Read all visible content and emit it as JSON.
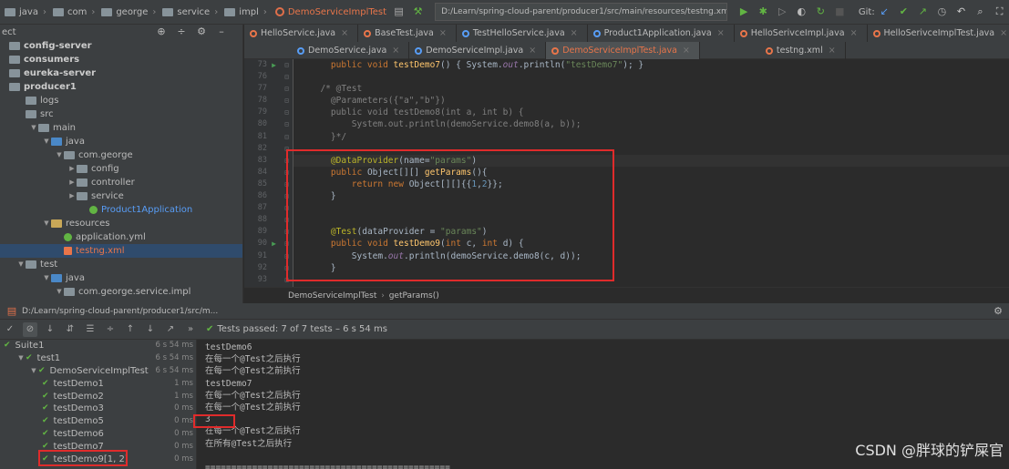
{
  "nav": {
    "crumbs": [
      "java",
      "com",
      "george",
      "service",
      "impl"
    ],
    "file": "DemoServiceImplTest",
    "path": "D:/Learn/spring-cloud-parent/producer1/src/main/resources/testng.xml",
    "git_label": "Git:"
  },
  "tree": {
    "header": "ect",
    "rows": [
      {
        "label": "config-server",
        "type": "f",
        "bold": true,
        "indent": 0
      },
      {
        "label": "consumers",
        "type": "f",
        "bold": true,
        "indent": 0
      },
      {
        "label": "eureka-server",
        "type": "f",
        "bold": true,
        "indent": 0
      },
      {
        "label": "producer1",
        "type": "f",
        "bold": true,
        "indent": 0
      },
      {
        "label": "logs",
        "type": "f",
        "indent": 1
      },
      {
        "label": "src",
        "type": "f",
        "indent": 1
      },
      {
        "label": "main",
        "type": "f",
        "indent": 2,
        "arrow": "down"
      },
      {
        "label": "java",
        "type": "b",
        "indent": 3,
        "arrow": "down"
      },
      {
        "label": "com.george",
        "type": "f",
        "indent": 4,
        "arrow": "down"
      },
      {
        "label": "config",
        "type": "f",
        "indent": 5,
        "arrow": "right"
      },
      {
        "label": "controller",
        "type": "f",
        "indent": 5,
        "arrow": "right"
      },
      {
        "label": "service",
        "type": "f",
        "indent": 5,
        "arrow": "right"
      },
      {
        "label": "Product1Application",
        "type": "g",
        "indent": 6,
        "cls": "link"
      },
      {
        "label": "resources",
        "type": "y",
        "indent": 3,
        "arrow": "down"
      },
      {
        "label": "application.yml",
        "type": "g",
        "indent": 4
      },
      {
        "label": "testng.xml",
        "type": "x",
        "indent": 4,
        "cls": "orange",
        "selected": true
      },
      {
        "label": "test",
        "type": "f",
        "indent": 1,
        "arrow": "down"
      },
      {
        "label": "java",
        "type": "b",
        "indent": 3,
        "arrow": "down"
      },
      {
        "label": "com.george.service.impl",
        "type": "f",
        "indent": 4,
        "arrow": "down"
      }
    ]
  },
  "tabs": {
    "row1": [
      {
        "label": "HelloService.java",
        "k": "j"
      },
      {
        "label": "BaseTest.java",
        "k": "j"
      },
      {
        "label": "TestHelloService.java",
        "k": "t"
      },
      {
        "label": "Product1Application.java",
        "k": "t"
      },
      {
        "label": "HelloSerivceImpl.java",
        "k": "j"
      },
      {
        "label": "HelloSerivceImplTest.java",
        "k": "j"
      }
    ],
    "row2": [
      {
        "label": "DemoService.java",
        "k": "t"
      },
      {
        "label": "DemoServiceImpl.java",
        "k": "t"
      },
      {
        "label": "DemoServiceImplTest.java",
        "k": "j",
        "active": true
      },
      {
        "label": "testng.xml",
        "k": "x"
      }
    ]
  },
  "code": {
    "lines": [
      {
        "n": "73",
        "run": true,
        "html": "    <span class='kw'>public void </span><span class='fn'>testDemo7</span>() { System.<span class='fi'>out</span>.println(<span class='st'>\"testDemo7\"</span>); }"
      },
      {
        "n": "76",
        "html": ""
      },
      {
        "n": "77",
        "html": "  <span class='cm'>/* @Test</span>"
      },
      {
        "n": "78",
        "html": "    <span class='cm'>@Parameters({\"a\",\"b\"})</span>"
      },
      {
        "n": "79",
        "html": "    <span class='cm'>public void testDemo8(int a, int b) {</span>"
      },
      {
        "n": "80",
        "html": "        <span class='cm'>System.out.println(demoService.demo8(a, b));</span>"
      },
      {
        "n": "81",
        "html": "    <span class='cm'>}*/</span>"
      },
      {
        "n": "82",
        "html": ""
      },
      {
        "n": "83",
        "cur": true,
        "html": "    <span class='an'>@DataProvider</span>(name=<span class='st'>\"params\"</span>)"
      },
      {
        "n": "84",
        "html": "    <span class='kw'>public </span>Object[][] <span class='fn'>getParams</span>(){"
      },
      {
        "n": "85",
        "html": "        <span class='kw'>return new </span>Object[][]{{<span class='nu'>1</span>,<span class='nu'>2</span>}};"
      },
      {
        "n": "86",
        "html": "    }"
      },
      {
        "n": "87",
        "html": ""
      },
      {
        "n": "88",
        "html": ""
      },
      {
        "n": "89",
        "html": "    <span class='an'>@Test</span>(dataProvider = <span class='st'>\"params\"</span>)"
      },
      {
        "n": "90",
        "run": true,
        "html": "    <span class='kw'>public void </span><span class='fn'>testDemo9</span>(<span class='kw'>int </span>c, <span class='kw'>int </span>d) {"
      },
      {
        "n": "91",
        "html": "        System.<span class='fi'>out</span>.println(demoService.demo8(c, d));"
      },
      {
        "n": "92",
        "html": "    }"
      },
      {
        "n": "93",
        "html": ""
      }
    ]
  },
  "breadcrumb": {
    "cls": "DemoServiceImplTest",
    "method": "getParams()"
  },
  "run": {
    "header": "D:/Learn/spring-cloud-parent/producer1/src/m...",
    "passed_label": "Tests passed:",
    "passed_count": "7 of 7 tests",
    "passed_time": "– 6 s 54 ms"
  },
  "results": [
    {
      "label": "Suite1",
      "indent": 0,
      "time": "6 s 54 ms",
      "arrow": ""
    },
    {
      "label": "test1",
      "indent": 1,
      "time": "6 s 54 ms",
      "arrow": "down"
    },
    {
      "label": "DemoServiceImplTest",
      "indent": 2,
      "time": "6 s 54 ms",
      "arrow": "down"
    },
    {
      "label": "testDemo1",
      "indent": 3,
      "time": "1 ms"
    },
    {
      "label": "testDemo2",
      "indent": 3,
      "time": "1 ms"
    },
    {
      "label": "testDemo3",
      "indent": 3,
      "time": "0 ms"
    },
    {
      "label": "testDemo5",
      "indent": 3,
      "time": "0 ms"
    },
    {
      "label": "testDemo6",
      "indent": 3,
      "time": "0 ms"
    },
    {
      "label": "testDemo7",
      "indent": 3,
      "time": "0 ms"
    },
    {
      "label": "testDemo9[1, 2]",
      "indent": 3,
      "time": "0 ms"
    }
  ],
  "console": [
    "testDemo6",
    "在每一个@Test之后执行",
    "在每一个@Test之前执行",
    "testDemo7",
    "在每一个@Test之后执行",
    "在每一个@Test之前执行",
    "3",
    "在每一个@Test之后执行",
    "在所有@Test之后执行",
    "",
    "==============================================="
  ],
  "watermark": "CSDN @胖球的铲屎官"
}
